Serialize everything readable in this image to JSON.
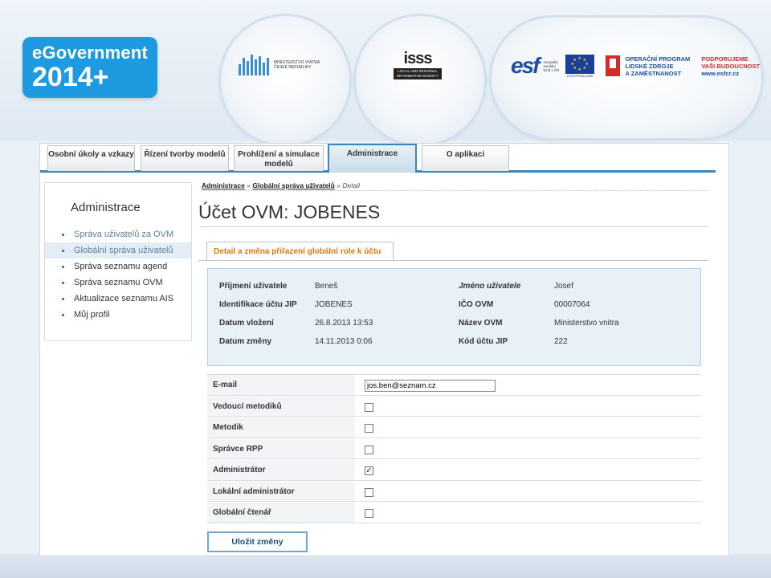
{
  "header": {
    "egov_line1": "eGovernment",
    "egov_line2": "2014+",
    "mv_logo_text": "MINISTERSTVO VNITRA ČESKÉ REPUBLIKY",
    "isss_big": "isss",
    "isss_small": "LOCAL AND REGIONAL INFORMATION SOCIETY",
    "esf_mark": "esf",
    "esf_small": "evropský sociální fond v ČR",
    "eu_label": "EVROPSKÁ UNIE",
    "op_text": [
      "OPERAČNÍ PROGRAM",
      "LIDSKÉ ZDROJE",
      "A ZAMĚSTNANOST"
    ],
    "op_slogan": [
      "PODPORUJEME",
      "VAŠI BUDOUCNOST"
    ],
    "op_url": "www.esfcr.cz"
  },
  "tabs": [
    {
      "label": "Osobní úkoly a vzkazy"
    },
    {
      "label": "Řízení tvorby modelů"
    },
    {
      "label": "Prohlížení a simulace modelů"
    },
    {
      "label": "Administrace"
    },
    {
      "label": "O aplikaci"
    }
  ],
  "sidebar": {
    "title": "Administrace",
    "items": [
      {
        "label": "Správa uživatelů za OVM"
      },
      {
        "label": "Globální správa uživatelů"
      },
      {
        "label": "Správa seznamu agend"
      },
      {
        "label": "Správa seznamu OVM"
      },
      {
        "label": "Aktualizace seznamu AIS"
      },
      {
        "label": "Můj profil"
      }
    ]
  },
  "breadcrumb": {
    "item1": "Administrace",
    "item2": "Globální správa uživatelů",
    "current": "Detail",
    "sep": "»"
  },
  "page": {
    "title": "Účet OVM: JOBENES",
    "content_tab": "Detail a změna přiřazení globální role k účtu"
  },
  "info": [
    {
      "label": "Příjmení uživatele",
      "value": "Beneš",
      "label2": "Jméno uživatele",
      "value2": "Josef"
    },
    {
      "label": "Identifikace účtu JIP",
      "value": "JOBENES",
      "label2": "IČO OVM",
      "value2": "00007064"
    },
    {
      "label": "Datum vložení",
      "value": "26.8.2013 13:53",
      "label2": "Název OVM",
      "value2": "Ministerstvo vnitra"
    },
    {
      "label": "Datum změny",
      "value": "14.11.2013 0:06",
      "label2": "Kód účtu JIP",
      "value2": "222"
    }
  ],
  "form": {
    "email_label": "E-mail",
    "email_value": "jos.ben@seznam.cz",
    "roles": [
      {
        "label": "Vedoucí metodiků",
        "checked": "false"
      },
      {
        "label": "Metodik",
        "checked": "false"
      },
      {
        "label": "Správce RPP",
        "checked": "false"
      },
      {
        "label": "Administrátor",
        "checked": "true"
      },
      {
        "label": "Lokální administrátor",
        "checked": "false"
      },
      {
        "label": "Globální čtenář",
        "checked": "false"
      }
    ],
    "check_mark": "✓",
    "save_label": "Uložit změny"
  }
}
